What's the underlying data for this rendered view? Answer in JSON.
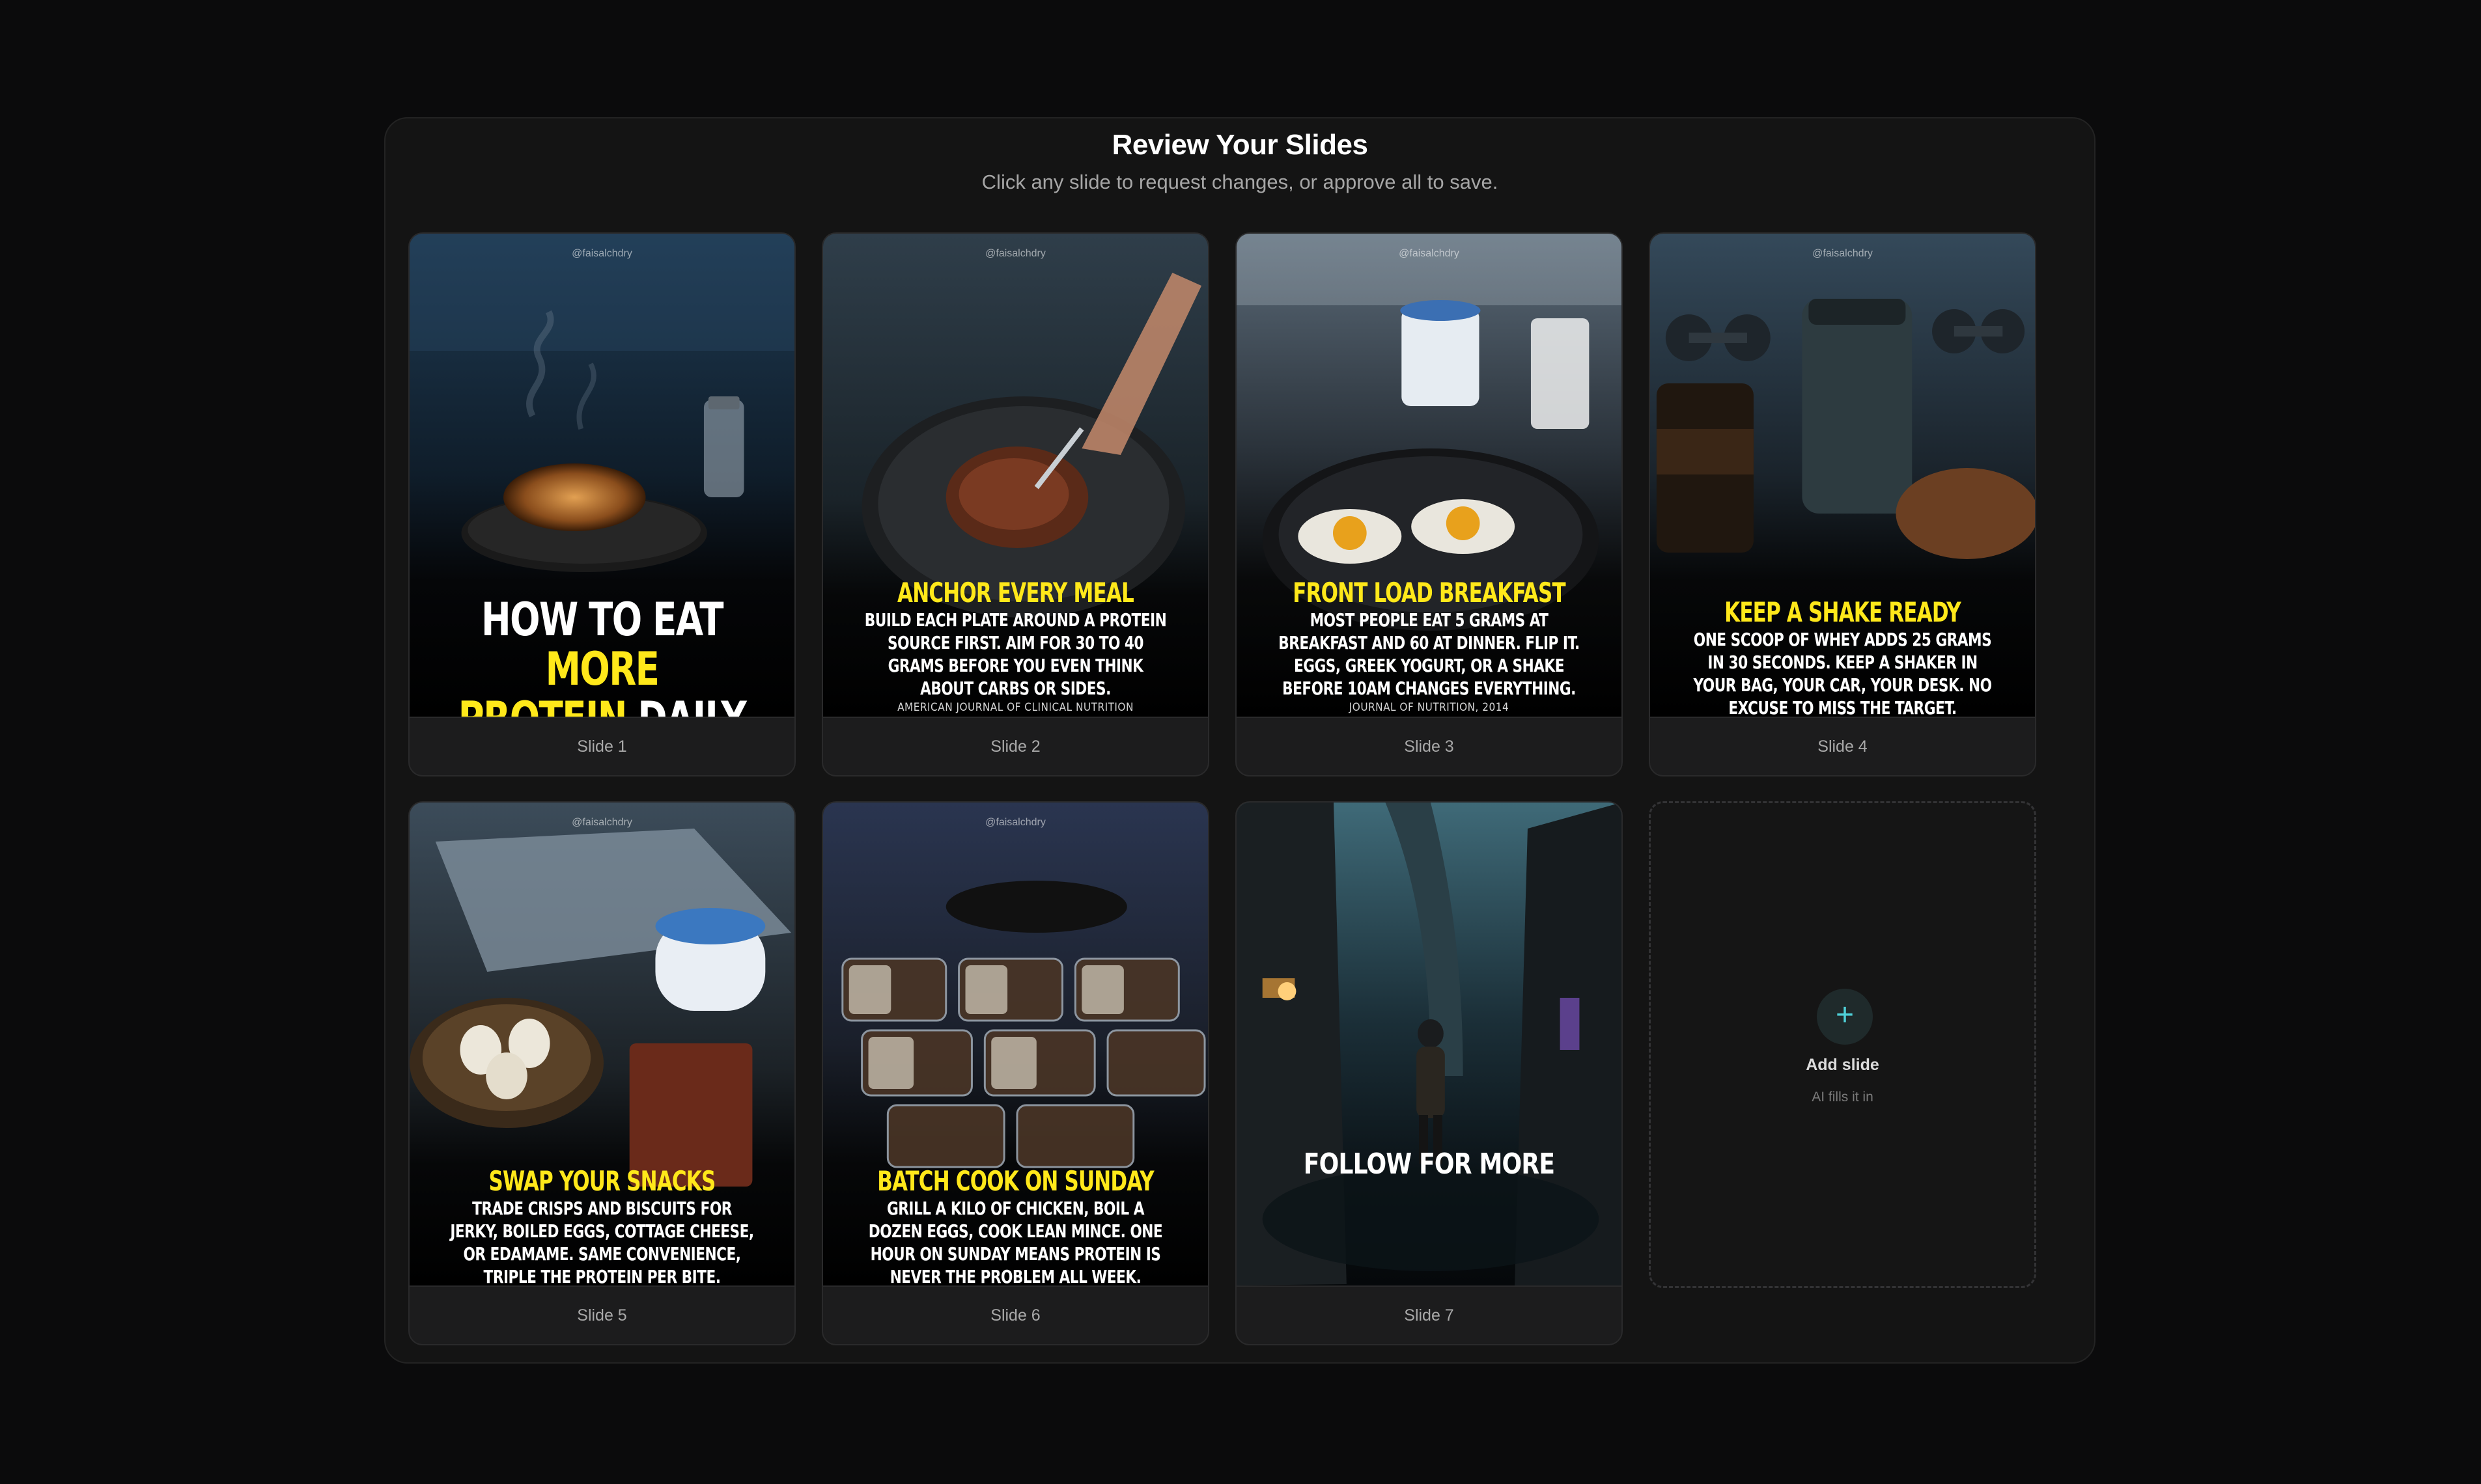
{
  "header": {
    "title": "Review Your Slides",
    "subtitle": "Click any slide to request changes, or approve all to save."
  },
  "handle": "@faisalchdry",
  "slides": [
    {
      "caption": "Slide 1",
      "title_part1": "HOW TO EAT ",
      "title_highlight1": "MORE",
      "title_highlight2": "PROTEIN",
      "title_part2": " DAILY",
      "image": "grilled-chicken-breast"
    },
    {
      "caption": "Slide 2",
      "headline": "ANCHOR EVERY MEAL",
      "body": "BUILD EACH PLATE AROUND A PROTEIN SOURCE FIRST. AIM FOR 30 TO 40 GRAMS BEFORE YOU EVEN THINK ABOUT CARBS OR SIDES.",
      "source": "AMERICAN JOURNAL OF CLINICAL NUTRITION",
      "image": "steak-on-plate"
    },
    {
      "caption": "Slide 3",
      "headline": "FRONT LOAD BREAKFAST",
      "body": "MOST PEOPLE EAT 5 GRAMS AT BREAKFAST AND 60 AT DINNER. FLIP IT. EGGS, GREEK YOGURT, OR A SHAKE BEFORE 10AM CHANGES EVERYTHING.",
      "source": "JOURNAL OF NUTRITION, 2014",
      "image": "eggs-greek-yogurt-milk"
    },
    {
      "caption": "Slide 4",
      "headline": "KEEP A SHAKE READY",
      "body": "ONE SCOOP OF WHEY ADDS 25 GRAMS IN 30 SECONDS. KEEP A SHAKER IN YOUR BAG, YOUR CAR, YOUR DESK. NO EXCUSE TO MISS THE TARGET.",
      "image": "whey-shaker-gym"
    },
    {
      "caption": "Slide 5",
      "headline": "SWAP YOUR SNACKS",
      "body": "TRADE CRISPS AND BISCUITS FOR JERKY, BOILED EGGS, COTTAGE CHEESE, OR EDAMAME. SAME CONVENIENCE, TRIPLE THE PROTEIN PER BITE.",
      "image": "laptop-eggs-cottage-cheese-jerky"
    },
    {
      "caption": "Slide 6",
      "headline": "BATCH COOK ON SUNDAY",
      "body": "GRILL A KILO OF CHICKEN, BOIL A DOZEN EGGS, COOK LEAN MINCE. ONE HOUR ON SUNDAY MEANS PROTEIN IS NEVER THE PROBLEM ALL WEEK.",
      "image": "meal-prep-containers"
    },
    {
      "caption": "Slide 7",
      "headline": "FOLLOW FOR MORE",
      "image": "man-walking-city-night"
    }
  ],
  "add_slide": {
    "label": "Add slide",
    "hint": "AI fills it in",
    "icon": "plus-icon"
  },
  "colors": {
    "accent_yellow": "#ffe81a",
    "accent_teal": "#4fd1d9",
    "panel": "#141414",
    "page": "#0b0b0c"
  }
}
